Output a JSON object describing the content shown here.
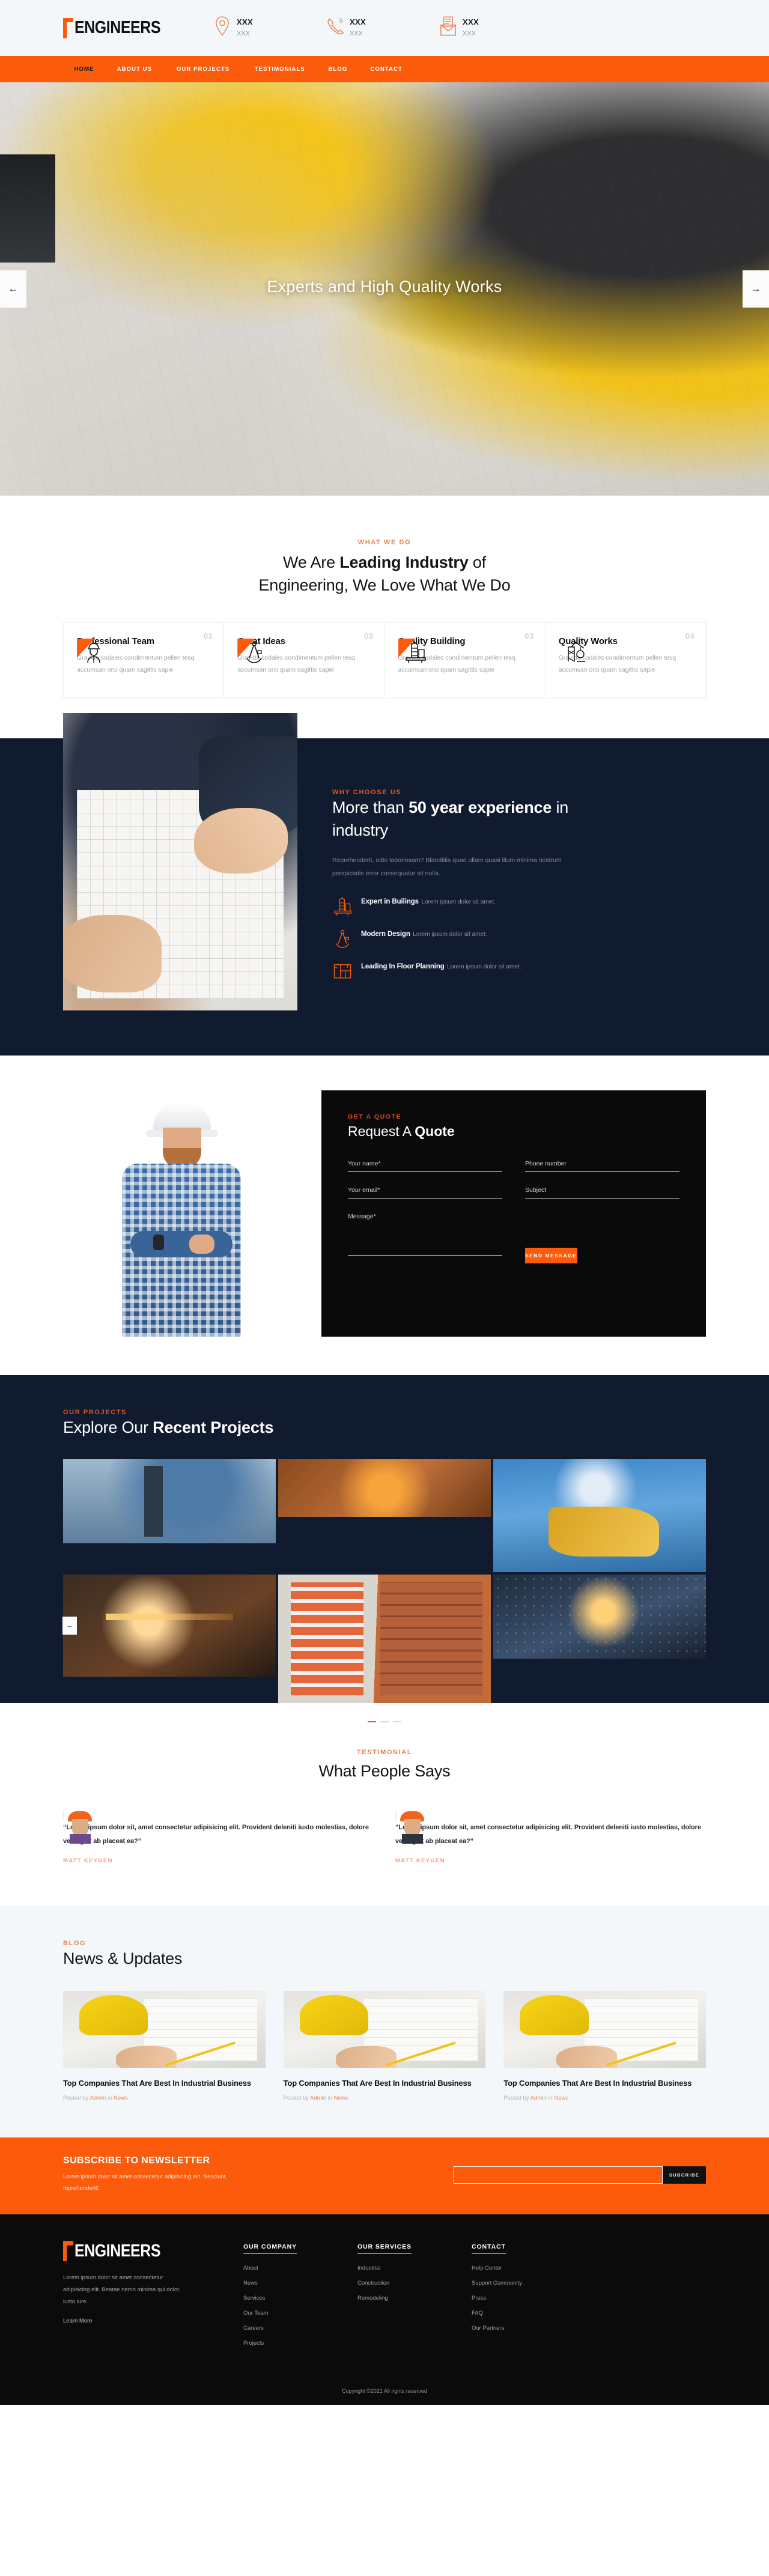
{
  "topbar": {
    "logo_text": "ENGINEERS",
    "contacts": [
      {
        "icon": "location-pin-icon",
        "top": "XXX",
        "sub": "XXX"
      },
      {
        "icon": "phone-icon",
        "top": "XXX",
        "sub": "XXX"
      },
      {
        "icon": "envelope-icon",
        "top": "XXX",
        "sub": "XXX"
      }
    ]
  },
  "nav": {
    "items": [
      {
        "label": "HOME",
        "active": true
      },
      {
        "label": "ABOUT US",
        "active": false
      },
      {
        "label": "OUR PROJECTS",
        "active": false
      },
      {
        "label": "TESTIMONIALS",
        "active": false
      },
      {
        "label": "BLOG",
        "active": false
      },
      {
        "label": "CONTACT",
        "active": false
      }
    ]
  },
  "hero": {
    "title": "Experts and High Quality Works",
    "prev_icon": "arrow-left-icon",
    "next_icon": "arrow-right-icon"
  },
  "whatwedo": {
    "tag": "WHAT WE DO",
    "title_pre": "We Are ",
    "title_bold": "Leading Industry",
    "title_post": " of",
    "title_line2": "Engineering, We Love What We Do",
    "cards": [
      {
        "num": "01",
        "icon": "engineer-worker-icon",
        "title": "Professional Team",
        "desc": "Gravida sodales condimentum pellen tesq accumsan orci quam sagittis sapie"
      },
      {
        "num": "02",
        "icon": "compass-divider-icon",
        "title": "Great Ideas",
        "desc": "Gravida sodales condimentum pellen tesq accumsan orci quam sagittis sapie"
      },
      {
        "num": "03",
        "icon": "oil-rig-icon",
        "title": "Quality Building",
        "desc": "Gravida sodales condimentum pellen tesq accumsan orci quam sagittis sapie"
      },
      {
        "num": "04",
        "icon": "crane-icon",
        "title": "Quality Works",
        "desc": "Gravida sodales condimentum pellen tesq accumsan orci quam sagittis sapie"
      }
    ]
  },
  "why": {
    "tag": "WHY CHOOSE US",
    "title_pre": "More than ",
    "title_bold": "50 year experience",
    "title_post": " in industry",
    "desc": "Reprehenderit, odio laboriosam? Blanditiis quae ullam quasi illum minima nostrum perspiciatis error consequatur sit nulla.",
    "items": [
      {
        "icon": "oil-rig-icon",
        "title": "Expert in Builings",
        "sub": "Lorem ipsum dolor sit amet."
      },
      {
        "icon": "compass-divider-icon",
        "title": "Modern Design",
        "sub": "Lorem ipsum dolor sit amet."
      },
      {
        "icon": "floor-plan-icon",
        "title": "Leading In Floor Planning",
        "sub": "Lorem ipsum dolor sit amet."
      }
    ]
  },
  "quote": {
    "tag": "GET A QUOTE",
    "title_pre": "Request A ",
    "title_bold": "Quote",
    "fields": {
      "name": "Your name*",
      "phone": "Phone number",
      "email": "Your email*",
      "subject": "Subject",
      "message": "Message*"
    },
    "submit_label": "SEND MESSAGE"
  },
  "projects": {
    "tag": "OUR PROJECTS",
    "title_pre": "Explore Our ",
    "title_bold": "Recent Projects",
    "prev_icon": "arrow-left-icon",
    "dots": [
      {
        "active": true
      },
      {
        "active": false
      },
      {
        "active": false
      }
    ]
  },
  "testimonials": {
    "tag": "TESTIMONIAL",
    "title": "What People Says",
    "items": [
      {
        "avatar": "avatar-worker-icon",
        "quote": "“Lorem ipsum dolor sit, amet consectetur adipisicing elit. Provident deleniti iusto molestias, dolore vel fugiat ab placeat ea?”",
        "name": "MATT KEYGEN"
      },
      {
        "avatar": "avatar-worker-icon",
        "quote": "“Lorem ipsum dolor sit, amet consectetur adipisicing elit. Provident deleniti iusto molestias, dolore vel fugiat ab placeat ea?”",
        "name": "MATT KEYGEN"
      }
    ]
  },
  "blog": {
    "tag": "BLOG",
    "title": "News & Updates",
    "posts": [
      {
        "title": "Top Companies That Are Best In Industrial Business",
        "meta_pre": "Posted by ",
        "meta_author": "Admin",
        "meta_mid": " in ",
        "meta_cat": "News"
      },
      {
        "title": "Top Companies That Are Best In Industrial Business",
        "meta_pre": "Posted by ",
        "meta_author": "Admin",
        "meta_mid": " in ",
        "meta_cat": "News"
      },
      {
        "title": "Top Companies That Are Best In Industrial Business",
        "meta_pre": "Posted by ",
        "meta_author": "Admin",
        "meta_mid": " in ",
        "meta_cat": "News"
      }
    ]
  },
  "newsletter": {
    "title": "SUBSCRIBE TO NEWSLETTER",
    "sub": "Lorem ipsum dolor sit amet consectetur adipisicing elit. Nesciunt, reprehenderit!",
    "input_placeholder": "",
    "button_label": "SUBCRIBE"
  },
  "footer": {
    "logo_text": "ENGINEERS",
    "desc": "Lorem ipsum dolor sit amet consectetur adipisicing elit. Beatae nemo minima qui dolor, iusto iure.",
    "learn_more": "Learn More",
    "columns": [
      {
        "heading": "OUR COMPANY",
        "links": [
          "About",
          "News",
          "Services",
          "Our Team",
          "Careers",
          "Projects"
        ]
      },
      {
        "heading": "OUR SERVICES",
        "links": [
          "Industrial",
          "Construction",
          "Remodeling"
        ]
      },
      {
        "heading": "CONTACT",
        "links": [
          "Help Center",
          "Support Community",
          "Press",
          "FAQ",
          "Our Partners"
        ]
      }
    ],
    "copyright": "Copyright ©2021 All rights reserved"
  },
  "colors": {
    "accent": "#fb5b0a",
    "navy": "#111b30",
    "dark": "#0a0a0a",
    "light_bg": "#f4f7fa"
  }
}
